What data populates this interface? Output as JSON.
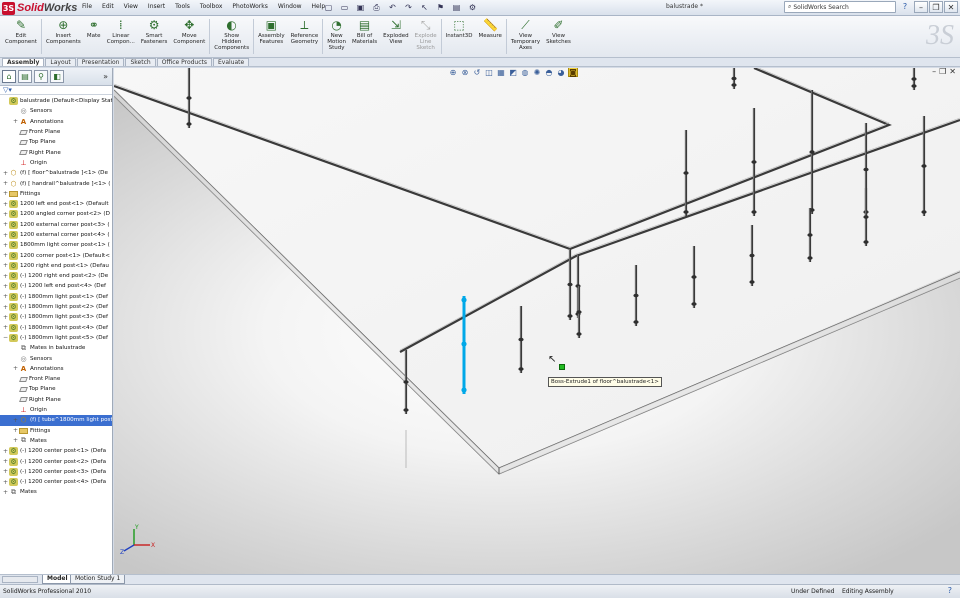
{
  "app": {
    "logo_prefix": "Solid",
    "logo_suffix": "Works",
    "doc_title": "balustrade *"
  },
  "menu": [
    "File",
    "Edit",
    "View",
    "Insert",
    "Tools",
    "Toolbox",
    "PhotoWorks",
    "Window",
    "Help"
  ],
  "search": {
    "placeholder": "SolidWorks Search"
  },
  "ribbon": [
    {
      "id": "edit-component",
      "label": "Edit\nComponent",
      "icon": "edit-component-icon",
      "glyph": "✎"
    },
    {
      "id": "insert-components",
      "label": "Insert\nComponents",
      "icon": "insert-components-icon",
      "glyph": "⊕"
    },
    {
      "id": "mate",
      "label": "Mate",
      "icon": "mate-icon",
      "glyph": "⚭"
    },
    {
      "id": "linear-component",
      "label": "Linear\nCompon...",
      "icon": "linear-pattern-icon",
      "glyph": "⁞"
    },
    {
      "id": "smart-fasteners",
      "label": "Smart\nFasteners",
      "icon": "smart-fasteners-icon",
      "glyph": "⚙"
    },
    {
      "id": "move-component",
      "label": "Move\nComponent",
      "icon": "move-component-icon",
      "glyph": "✥"
    },
    {
      "id": "show-hidden",
      "label": "Show\nHidden\nComponents",
      "icon": "show-hidden-icon",
      "glyph": "◐"
    },
    {
      "id": "assembly-features",
      "label": "Assembly\nFeatures",
      "icon": "assembly-features-icon",
      "glyph": "▣"
    },
    {
      "id": "reference-geometry",
      "label": "Reference\nGeometry",
      "icon": "reference-geometry-icon",
      "glyph": "⟂"
    },
    {
      "id": "new-motion-study",
      "label": "New\nMotion\nStudy",
      "icon": "motion-study-icon",
      "glyph": "◔"
    },
    {
      "id": "bill-of-materials",
      "label": "Bill of\nMaterials",
      "icon": "bom-icon",
      "glyph": "▤"
    },
    {
      "id": "exploded-view",
      "label": "Exploded\nView",
      "icon": "exploded-view-icon",
      "glyph": "⇲"
    },
    {
      "id": "explode-line-sketch",
      "label": "Explode\nLine\nSketch",
      "icon": "explode-line-icon",
      "glyph": "⤡",
      "disabled": true
    },
    {
      "id": "instant3d",
      "label": "Instant3D",
      "icon": "instant3d-icon",
      "glyph": "⬚"
    },
    {
      "id": "measure",
      "label": "Measure",
      "icon": "measure-icon",
      "glyph": "📏"
    },
    {
      "id": "view-temporary-axes",
      "label": "View\nTemporary\nAxes",
      "icon": "temporary-axes-icon",
      "glyph": "⟋"
    },
    {
      "id": "view-sketches",
      "label": "View\nSketches",
      "icon": "view-sketches-icon",
      "glyph": "✐"
    }
  ],
  "cm_tabs": [
    "Assembly",
    "Layout",
    "Presentation",
    "Sketch",
    "Office Products",
    "Evaluate"
  ],
  "cm_active": "Assembly",
  "filter_glyph": "▽▾",
  "tree": [
    {
      "t": "balustrade  (Default<Display State-",
      "i": "asm",
      "e": "",
      "lvl": 0
    },
    {
      "t": "Sensors",
      "i": "sens",
      "e": "",
      "lvl": 1
    },
    {
      "t": "Annotations",
      "i": "anno",
      "e": "+",
      "lvl": 1
    },
    {
      "t": "Front Plane",
      "i": "plane",
      "e": "",
      "lvl": 1
    },
    {
      "t": "Top Plane",
      "i": "plane",
      "e": "",
      "lvl": 1
    },
    {
      "t": "Right Plane",
      "i": "plane",
      "e": "",
      "lvl": 1
    },
    {
      "t": "Origin",
      "i": "orig",
      "e": "",
      "lvl": 1
    },
    {
      "t": "(f) [ floor^balustrade ]<1> (De",
      "i": "part",
      "e": "+",
      "lvl": 0
    },
    {
      "t": "(f) [ handrail^balustrade ]<1> (",
      "i": "part",
      "e": "+",
      "lvl": 0
    },
    {
      "t": "Fittings",
      "i": "fold",
      "e": "+",
      "lvl": 0
    },
    {
      "t": "1200 left end post<1> (Default",
      "i": "asm",
      "e": "+",
      "lvl": 0
    },
    {
      "t": "1200 angled corner post<2> (D",
      "i": "asm",
      "e": "+",
      "lvl": 0
    },
    {
      "t": "1200 external corner post<3> (",
      "i": "asm",
      "e": "+",
      "lvl": 0
    },
    {
      "t": "1200 external corner post<4> (",
      "i": "asm",
      "e": "+",
      "lvl": 0
    },
    {
      "t": "1800mm light corner post<1> (",
      "i": "asm",
      "e": "+",
      "lvl": 0
    },
    {
      "t": "1200 corner post<1> (Default<",
      "i": "asm",
      "e": "+",
      "lvl": 0
    },
    {
      "t": "1200 right end post<1> (Defau",
      "i": "asm",
      "e": "+",
      "lvl": 0
    },
    {
      "t": "(-) 1200 right end post<2> (De",
      "i": "asm",
      "e": "+",
      "lvl": 0
    },
    {
      "t": "(-) 1200 left end post<4> (Def",
      "i": "asm",
      "e": "+",
      "lvl": 0
    },
    {
      "t": "(-) 1800mm light post<1> (Def",
      "i": "asm",
      "e": "+",
      "lvl": 0
    },
    {
      "t": "(-) 1800mm light post<2> (Def",
      "i": "asm",
      "e": "+",
      "lvl": 0
    },
    {
      "t": "(-) 1800mm light post<3> (Def",
      "i": "asm",
      "e": "+",
      "lvl": 0
    },
    {
      "t": "(-) 1800mm light post<4> (Def",
      "i": "asm",
      "e": "+",
      "lvl": 0
    },
    {
      "t": "(-) 1800mm light post<5> (Def",
      "i": "asm",
      "e": "−",
      "lvl": 0
    },
    {
      "t": "Mates in balustrade",
      "i": "mates",
      "e": "",
      "lvl": 1
    },
    {
      "t": "Sensors",
      "i": "sens",
      "e": "",
      "lvl": 1
    },
    {
      "t": "Annotations",
      "i": "anno",
      "e": "+",
      "lvl": 1
    },
    {
      "t": "Front Plane",
      "i": "plane",
      "e": "",
      "lvl": 1
    },
    {
      "t": "Top Plane",
      "i": "plane",
      "e": "",
      "lvl": 1
    },
    {
      "t": "Right Plane",
      "i": "plane",
      "e": "",
      "lvl": 1
    },
    {
      "t": "Origin",
      "i": "orig",
      "e": "",
      "lvl": 1
    },
    {
      "t": "(f) [ tube^1800mm light post",
      "i": "part",
      "e": "+",
      "lvl": 1,
      "sel": true
    },
    {
      "t": "Fittings",
      "i": "fold",
      "e": "+",
      "lvl": 1
    },
    {
      "t": "Mates",
      "i": "mates",
      "e": "+",
      "lvl": 1
    },
    {
      "t": "(-) 1200 center post<1> (Defa",
      "i": "asm",
      "e": "+",
      "lvl": 0
    },
    {
      "t": "(-) 1200 center post<2> (Defa",
      "i": "asm",
      "e": "+",
      "lvl": 0
    },
    {
      "t": "(-) 1200 center post<3> (Defa",
      "i": "asm",
      "e": "+",
      "lvl": 0
    },
    {
      "t": "(-) 1200 center post<4> (Defa",
      "i": "asm",
      "e": "+",
      "lvl": 0
    },
    {
      "t": "Mates",
      "i": "mates",
      "e": "+",
      "lvl": 0
    }
  ],
  "bottom_tabs": [
    "Model",
    "Motion Study 1"
  ],
  "tooltip": "Boss-Extrude1 of floor^balustrade<1>",
  "triad": {
    "x": "X",
    "y": "Y",
    "z": "Z"
  },
  "colors": {
    "selected": "#00a8e8",
    "rail": "#3a3a3a",
    "floor_edge": "#555555"
  },
  "status": {
    "product": "SolidWorks Professional 2010",
    "state": "Under Defined",
    "mode": "Editing Assembly"
  }
}
